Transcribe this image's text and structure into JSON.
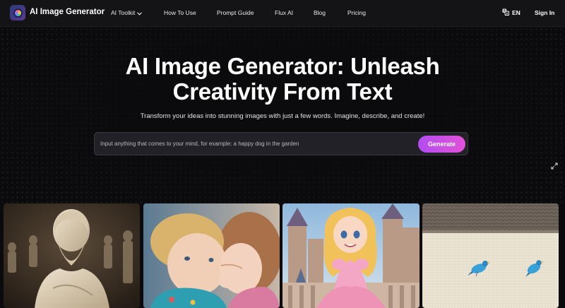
{
  "nav": {
    "logo_text": "AI Image Generator",
    "items": [
      {
        "label": "AI Toolkit",
        "has_dropdown": true
      },
      {
        "label": "How To Use"
      },
      {
        "label": "Prompt Guide"
      },
      {
        "label": "Flux AI"
      },
      {
        "label": "Blog"
      },
      {
        "label": "Pricing"
      }
    ],
    "language": "EN",
    "signin": "Sign In"
  },
  "hero": {
    "title_line1": "AI Image Generator: Unleash",
    "title_line2": "Creativity From Text",
    "subtitle": "Transform your ideas into stunning images with just a few words. Imagine, describe, and create!",
    "input_placeholder": "Input anything that comes to your mind, for example: a happy dog in the garden",
    "generate_label": "Generate"
  },
  "colors": {
    "background": "#0b0b0d",
    "nav_bg": "#141416",
    "button_gradient_start": "#b44cf0",
    "button_gradient_end": "#e052d9"
  },
  "gallery": [
    {
      "name": "marble-bust-image"
    },
    {
      "name": "hugging-children-image"
    },
    {
      "name": "cartoon-princess-image"
    },
    {
      "name": "birds-on-wall-image"
    }
  ]
}
